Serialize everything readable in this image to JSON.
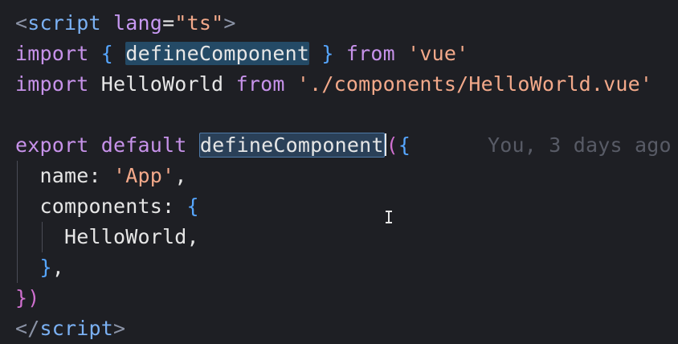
{
  "lines": {
    "l1": {
      "tag_open": "<",
      "tagname": "script",
      "attr": "lang",
      "eq": "=",
      "value": "\"ts\"",
      "tag_close": ">"
    },
    "l2": {
      "kw_import": "import",
      "brace_open": "{",
      "ident": "defineComponent",
      "brace_close": "}",
      "kw_from": "from",
      "module": "'vue'"
    },
    "l3": {
      "kw_import": "import",
      "ident": "HelloWorld",
      "kw_from": "from",
      "module": "'./components/HelloWorld.vue'"
    },
    "l5": {
      "kw_export": "export",
      "kw_default": "default",
      "call": "defineComponent",
      "paren": "(",
      "brace": "{"
    },
    "l6": {
      "key": "name:",
      "value": "'App'",
      "comma": ","
    },
    "l7": {
      "key": "components:",
      "brace": "{"
    },
    "l8": {
      "ident": "HelloWorld",
      "comma": ","
    },
    "l9": {
      "brace": "}",
      "comma": ","
    },
    "l10": {
      "brace": "}",
      "paren": ")"
    },
    "l11": {
      "tag_open": "</",
      "tagname": "script",
      "tag_close": ">"
    }
  },
  "blame": "You, 3 days ago",
  "colors": {
    "background": "#1e1f24",
    "keyword": "#c792ea",
    "string": "#f3a98a",
    "tag": "#7bb1f4",
    "brace": "#56a6ff",
    "highlight": "#244a66"
  }
}
